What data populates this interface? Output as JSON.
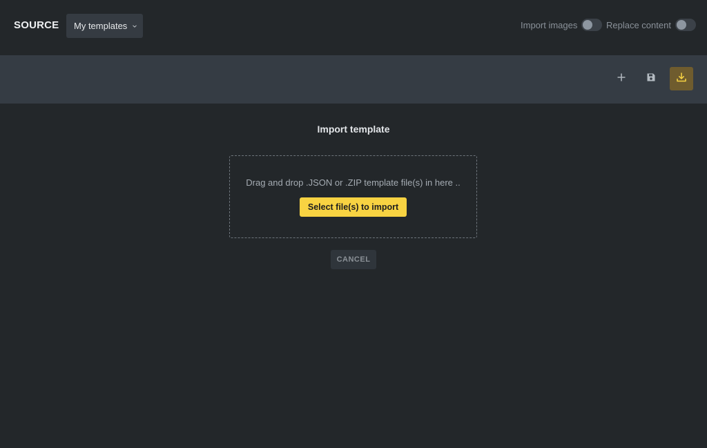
{
  "header": {
    "title": "SOURCE",
    "template_select": {
      "value": "My templates",
      "icon": "chevron-down-icon"
    },
    "toggles": [
      {
        "label": "Import images",
        "checked": false
      },
      {
        "label": "Replace content",
        "checked": false
      }
    ]
  },
  "toolbar": {
    "buttons": [
      {
        "icon": "plus-icon",
        "active": false
      },
      {
        "icon": "save-icon",
        "active": false
      },
      {
        "icon": "download-icon",
        "active": true
      }
    ]
  },
  "import": {
    "title": "Import template",
    "dropzone_text": "Drag and drop .JSON or .ZIP template file(s) in here ..",
    "select_button": "Select file(s) to import",
    "cancel_button": "CANCEL"
  },
  "colors": {
    "background": "#23272a",
    "toolbar": "#353c44",
    "accent": "#f8d342",
    "active_tool": "#6f5c2e"
  }
}
